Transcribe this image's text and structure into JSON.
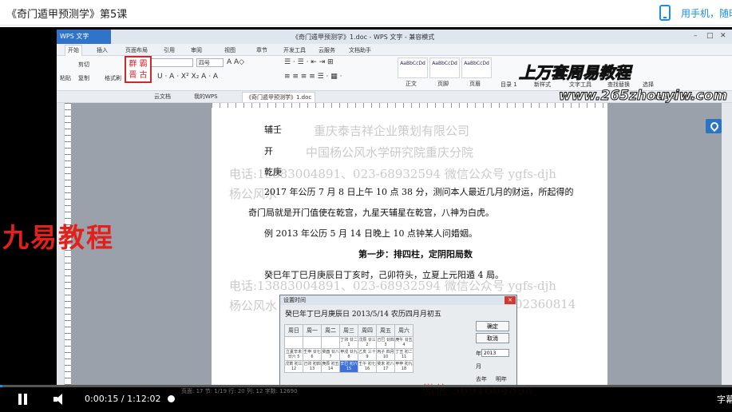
{
  "header": {
    "course_title": "《奇门遁甲预测学》第5课",
    "phone_link": "用手机，随时"
  },
  "app": {
    "wps_button": "WPS 文字",
    "doc_title": "《奇门遁甲预测学》1.doc - WPS 文字 - 兼容模式",
    "menus": [
      "开始",
      "插入",
      "页面布局",
      "引用",
      "审阅",
      "视图",
      "章节",
      "开发工具",
      "云服务",
      "文档助手"
    ],
    "ribbon": {
      "cut": "剪切",
      "copy": "复制",
      "format_painter": "格式刷",
      "paste": "粘贴",
      "font_name": "宋体",
      "font_size": "四号",
      "styles": [
        {
          "sample": "AaBbCcDd",
          "name": "正文"
        },
        {
          "sample": "AaBbCcDd",
          "name": "页脚"
        },
        {
          "sample": "AaBbCcDd",
          "name": "页眉"
        }
      ],
      "catalog": "目录 1",
      "new_style": "新样式",
      "text_tools": "文字工具",
      "find_replace": "查找替换",
      "select": "选择"
    },
    "stamp_text": "群 霸 晋 古",
    "tabs": [
      "云文档",
      "我的WPS",
      "《奇门遁甲预测学》1.doc"
    ],
    "search_placeholder": "查找命令、搜索..."
  },
  "document": {
    "lines": [
      "辅壬",
      "开",
      "乾庚",
      "2017 年公历 7 月 8 日上午 10 点 38 分，测问本人最近几月的财运，所起得的",
      "奇门局就是开门值使在乾宫，九星天辅星在乾宫，八神为白虎。",
      "例 2013 年公历 5 月 14 日晚上 10 点钟某人问婚姻。",
      "第一步：排四柱，定阴阳局数",
      "癸巳年丁巳月庚辰日丁亥时，己卯符头，立夏上元阳遁 4 局。"
    ],
    "watermarks": [
      "重庆泰吉祥企业策划有限公司",
      "中国杨公风水学研究院重庆分院",
      "电话:13883004891、023-68932594 微信公众号 ygfs-djh",
      "杨公风水",
      "电话:13883004891、023-68932594 微信公众号 ygfs-djh",
      "杨公风水",
      "02360814"
    ]
  },
  "dialog": {
    "title": "设置时间",
    "header": "癸巳年丁巳月庚辰日  2013/5/14  农历四月月初五",
    "weekdays": [
      "周日",
      "周一",
      "周二",
      "周三",
      "周四",
      "周五",
      "周六"
    ],
    "rows": [
      [
        "",
        "",
        "",
        "丁卯 廿二 1",
        "戊辰 廿三 2",
        "己巳 廿四 3",
        "庚午 廿五 4"
      ],
      [
        "立夏辛未 廿六 5",
        "壬申 廿七 6",
        "癸酉 廿八 7",
        "甲戌 廿九 8",
        "乙亥 三十 9",
        "丙子 四月 10",
        "丁丑 初二 11"
      ],
      [
        "戊寅 初三 12",
        "己卯 初四 13",
        "庚辰 初五 14",
        "辛巳 初六 15",
        "壬午 初七 16",
        "癸未 初八 17",
        "甲申 初九 18"
      ]
    ],
    "ok": "确定",
    "cancel": "取消",
    "year_label": "年",
    "year_value": "2013",
    "month_label": "月",
    "last_year": "去年",
    "next_year": "明年"
  },
  "overlays": {
    "title": "上万套周易教程",
    "url": "www.265zhouyiw.com",
    "brand": "九易教程",
    "contact": "微信 3691664898"
  },
  "player": {
    "current_time": "0:00:15",
    "separator": "/",
    "total_time": "1:12:02",
    "progress": 0.0035,
    "subtitle": "字幕",
    "status": "页面: 17  节: 1/19  行: 20  列: 12  字数: 12690",
    "accent_color": "#1a8fe0"
  }
}
